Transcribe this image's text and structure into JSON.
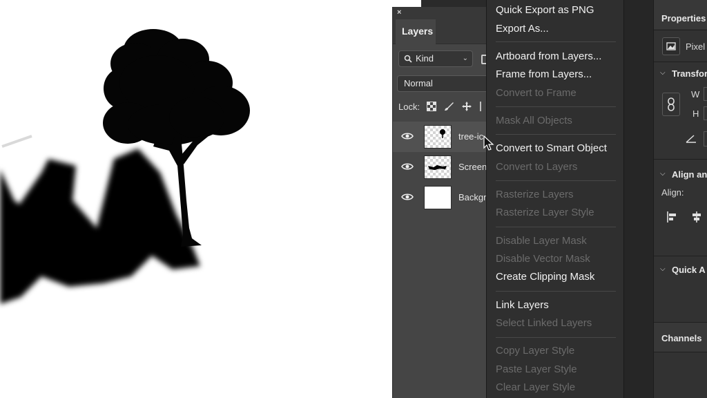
{
  "layers_panel": {
    "close_glyph": "×",
    "tab_title": "Layers",
    "filter_kind": "Kind",
    "blend_mode": "Normal",
    "lock_label": "Lock:",
    "layers": [
      {
        "name": "tree-ic",
        "visible": true,
        "thumbnail": "tree"
      },
      {
        "name": "Screen",
        "visible": true,
        "thumbnail": "brush-stroke"
      },
      {
        "name": "Backgr",
        "visible": true,
        "thumbnail": "white"
      }
    ]
  },
  "context_menu": {
    "items": [
      {
        "label": "Quick Export as PNG",
        "enabled": true
      },
      {
        "label": "Export As...",
        "enabled": true
      },
      {
        "label": "Artboard from Layers...",
        "enabled": true
      },
      {
        "label": "Frame from Layers...",
        "enabled": true
      },
      {
        "label": "Convert to Frame",
        "enabled": false
      },
      {
        "label": "Mask All Objects",
        "enabled": false
      },
      {
        "label": "Convert to Smart Object",
        "enabled": true
      },
      {
        "label": "Convert to Layers",
        "enabled": false
      },
      {
        "label": "Rasterize Layers",
        "enabled": false
      },
      {
        "label": "Rasterize Layer Style",
        "enabled": false
      },
      {
        "label": "Disable Layer Mask",
        "enabled": false
      },
      {
        "label": "Disable Vector Mask",
        "enabled": false
      },
      {
        "label": "Create Clipping Mask",
        "enabled": true
      },
      {
        "label": "Link Layers",
        "enabled": true
      },
      {
        "label": "Select Linked Layers",
        "enabled": false
      },
      {
        "label": "Copy Layer Style",
        "enabled": false
      },
      {
        "label": "Paste Layer Style",
        "enabled": false
      },
      {
        "label": "Clear Layer Style",
        "enabled": false
      }
    ]
  },
  "properties_panel": {
    "title": "Properties",
    "layer_type": "Pixel",
    "transform_title": "Transfor",
    "w_label": "W",
    "h_label": "H",
    "align_title": "Align an",
    "align_label": "Align:",
    "quick_actions_title": "Quick A",
    "channels_tab": "Channels"
  },
  "colors": {
    "menu_bg": "#2f2f2f",
    "panel_bg": "#454545",
    "disabled_text": "#6b6b6b"
  }
}
